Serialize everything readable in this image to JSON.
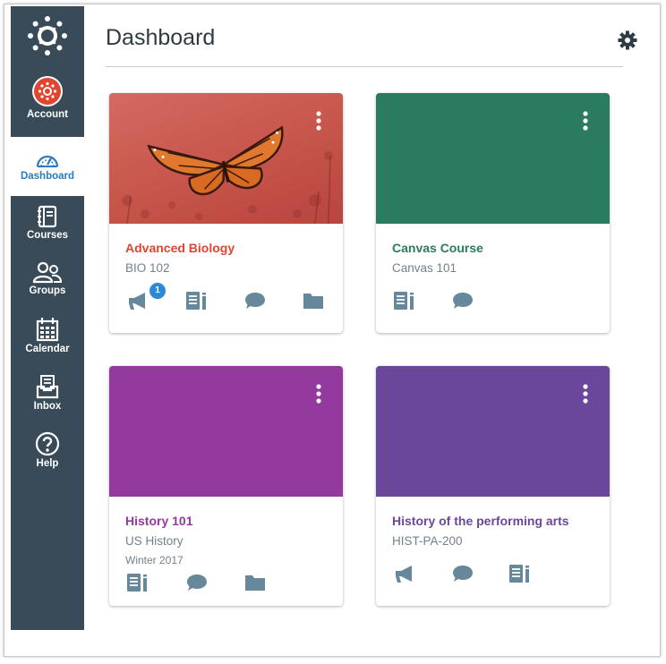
{
  "sidebar": {
    "logo_icon": "canvas-logo-icon",
    "items": [
      {
        "label": "Account",
        "icon": "account-avatar"
      },
      {
        "label": "Dashboard",
        "icon": "dashboard-gauge-icon"
      },
      {
        "label": "Courses",
        "icon": "courses-book-icon"
      },
      {
        "label": "Groups",
        "icon": "groups-people-icon"
      },
      {
        "label": "Calendar",
        "icon": "calendar-icon"
      },
      {
        "label": "Inbox",
        "icon": "inbox-icon"
      },
      {
        "label": "Help",
        "icon": "help-icon"
      }
    ],
    "active": "Dashboard",
    "bg_color": "#394b58",
    "active_color": "#2b7abc"
  },
  "header": {
    "title": "Dashboard",
    "settings_icon": "gear-icon"
  },
  "cards": [
    {
      "title": "Advanced Biology",
      "code": "BIO 102",
      "term": "",
      "color": "#e0452f",
      "hero": "butterfly-image",
      "icons": [
        "announcements-icon",
        "assignments-icon",
        "discussions-icon",
        "files-icon"
      ],
      "announcement_badge": "1"
    },
    {
      "title": "Canvas Course",
      "code": "Canvas 101",
      "term": "",
      "color": "#2a7b5f",
      "icons": [
        "assignments-icon",
        "discussions-icon"
      ]
    },
    {
      "title": "History 101",
      "code": "US History",
      "term": "Winter 2017",
      "color": "#943a9e",
      "icons": [
        "assignments-icon",
        "discussions-icon",
        "files-icon"
      ]
    },
    {
      "title": "History of the performing arts",
      "code": "HIST-PA-200",
      "term": "",
      "color": "#6b479c",
      "icons": [
        "announcements-icon",
        "discussions-icon",
        "assignments-icon"
      ]
    }
  ]
}
